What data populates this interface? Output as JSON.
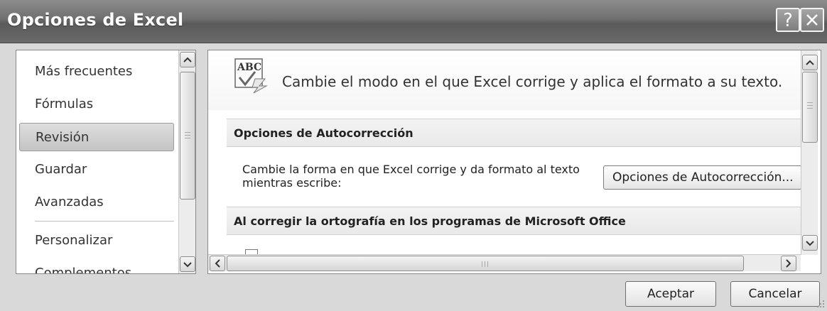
{
  "window": {
    "title": "Opciones de Excel",
    "help_glyph": "?",
    "close_icon": "close-icon"
  },
  "sidebar": {
    "items": [
      {
        "label": "Más frecuentes",
        "selected": false
      },
      {
        "label": "Fórmulas",
        "selected": false
      },
      {
        "label": "Revisión",
        "selected": true
      },
      {
        "label": "Guardar",
        "selected": false
      },
      {
        "label": "Avanzadas",
        "selected": false
      },
      {
        "label": "Personalizar",
        "selected": false
      },
      {
        "label": "Complementos",
        "selected": false
      }
    ]
  },
  "main": {
    "banner_icon": "abc-spellcheck-icon",
    "banner_text": "Cambie el modo en el que Excel corrige y aplica el formato a su texto.",
    "sections": [
      {
        "title": "Opciones de Autocorrección"
      },
      {
        "title": "Al corregir la ortografía en los programas de Microsoft Office"
      }
    ],
    "autocorrect_description": "Cambie la forma en que Excel corrige y da formato al texto mientras escribe:",
    "autocorrect_button_label": "Opciones de Autocorrección..."
  },
  "footer": {
    "ok_label": "Aceptar",
    "cancel_label": "Cancelar"
  },
  "colors": {
    "titlebar": "#6f6f6f",
    "selected_item": "#cfcfcf",
    "section_header": "#ededed"
  }
}
